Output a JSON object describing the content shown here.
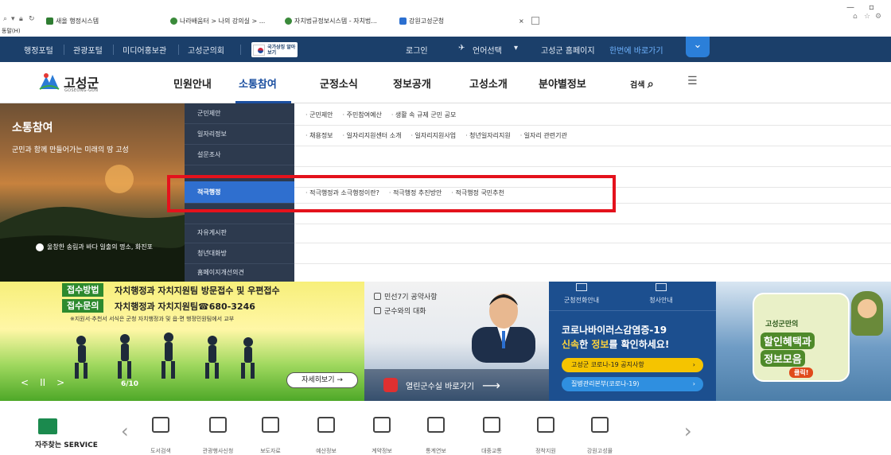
{
  "browser": {
    "menu_text": "동말(H)",
    "tabs": [
      "새올 행정시스템",
      "나라배움터 > 나의 강의실 > ...",
      "자치법규정보시스템 - 자치법...",
      "강원고성군청"
    ],
    "tab_close": "×"
  },
  "topbar": {
    "links": [
      "행정포털",
      "관광포털",
      "미디어홍보관",
      "고성군의회"
    ],
    "badge_text": "국가상징 알아보기",
    "login": "로그인",
    "language": "언어선택",
    "shortcut_prefix": "고성군 홈페이지",
    "shortcut_highlight": "한번에 바로가기",
    "toggle": "⌄"
  },
  "mainnav": {
    "logo_text": "고성군",
    "logo_sub": "GOSEONG-GUN",
    "items": [
      "민원안내",
      "소통참여",
      "군정소식",
      "정보공개",
      "고성소개",
      "분야별정보"
    ],
    "search": "검색",
    "menu_icon": "☰"
  },
  "mega": {
    "hero_title": "소통참여",
    "hero_desc": "군민과 함께 만들어가는 미래의 땅 고성",
    "hero_caption": "울창한 송림과 바다 일출의 명소, 화진포",
    "left_menu": [
      "군민제안",
      "일자리정보",
      "설문조사",
      "",
      "적극행정",
      "",
      "자유게시판",
      "청년대화방",
      "홈페이지개선의견"
    ],
    "right_rows": [
      [
        "군민제안",
        "주민참여예산",
        "생활 속 규제 군민 공모"
      ],
      [
        "채용정보",
        "일자리지원센터 소개",
        "일자리지원사업",
        "청년일자리지원",
        "일자리 관련기관"
      ],
      [],
      [],
      [
        "적극행정과 소극행정이란?",
        "적극행정 추진방안",
        "적극행정 국민추천"
      ]
    ]
  },
  "banner1": {
    "tag1": "접수방법",
    "text1": "자치행정과 자치지원팀 방문접수 및 우편접수",
    "tag2": "접수문의",
    "text2": "자치행정과 자치지원팀☎680-3246",
    "note": "※지원서·추천서 서식은 군청 자치행정과 및 읍·면 행정민원팀에서 교부",
    "controls": [
      "<",
      "II",
      ">"
    ],
    "page": "6/10",
    "more": "자세히보기 →"
  },
  "banner2": {
    "item1": "민선7기 공약사항",
    "item2": "군수와의 대화",
    "bottom": "열린군수실 바로가기",
    "arrow": "⟶"
  },
  "banner3": {
    "icons": [
      "군청전화안내",
      "청사안내"
    ],
    "title": "코로나바이러스감염증-19",
    "sub_prefix": "신속",
    "sub_mid": "한 ",
    "sub_hl": "정보",
    "sub_suffix": "를 확인하세요!",
    "btn1": "고성군 코로나-19 공지사항",
    "btn2": "질병관리본부(코로나-19)",
    "btn_arrow": "›",
    "btn1_bg": "#f5c400",
    "btn2_bg": "#2f8fe0"
  },
  "banner4": {
    "t1": "고성군만의",
    "t2": "할인혜택과",
    "t3": "정보모음",
    "t4": "클릭!"
  },
  "quick": {
    "title": "자주찾는 SERVICE",
    "items": [
      "도서검색",
      "관광행사신청",
      "보도자료",
      "예산정보",
      "계약정보",
      "통계연보",
      "대중교통",
      "정착지원",
      "강원고성몰"
    ],
    "prev": "‹",
    "next": "›"
  },
  "colors": {
    "topbar": "#1b3f6a",
    "accent": "#1b4fa0",
    "highlight_box": "#e4121c",
    "active_menu": "#2f6fcf"
  }
}
